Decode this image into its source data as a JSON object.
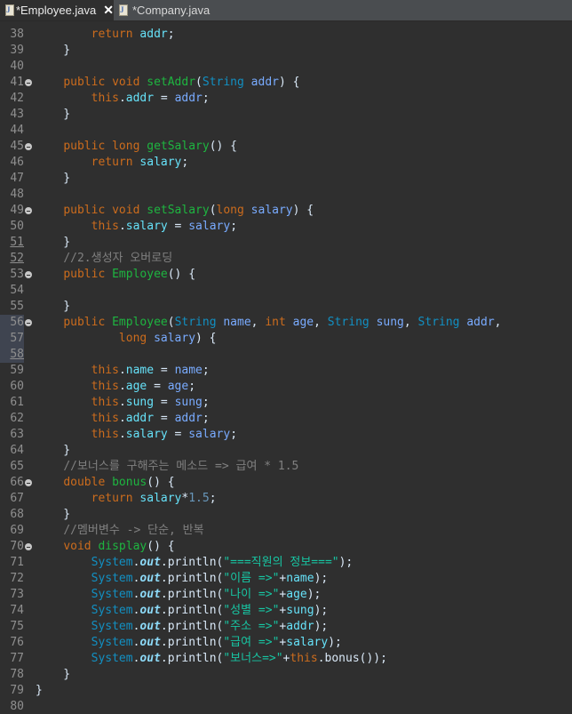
{
  "tabs": [
    {
      "label": "*Employee.java",
      "active": true
    },
    {
      "label": "*Company.java",
      "active": false
    }
  ],
  "icons": {
    "file": "java-file-icon",
    "close": "close-icon"
  },
  "code_lines": [
    {
      "n": "38",
      "text": "        return addr;"
    },
    {
      "n": "39",
      "text": "    }"
    },
    {
      "n": "40",
      "text": ""
    },
    {
      "n": "41",
      "text": "    public void setAddr(String addr) {",
      "fold": true
    },
    {
      "n": "42",
      "text": "        this.addr = addr;"
    },
    {
      "n": "43",
      "text": "    }"
    },
    {
      "n": "44",
      "text": ""
    },
    {
      "n": "45",
      "text": "    public long getSalary() {",
      "fold": true
    },
    {
      "n": "46",
      "text": "        return salary;"
    },
    {
      "n": "47",
      "text": "    }"
    },
    {
      "n": "48",
      "text": ""
    },
    {
      "n": "49",
      "text": "    public void setSalary(long salary) {",
      "fold": true
    },
    {
      "n": "50",
      "text": "        this.salary = salary;"
    },
    {
      "n": "51",
      "text": "    }"
    },
    {
      "n": "52",
      "text": "    //2.생성자 오버로딩"
    },
    {
      "n": "53",
      "text": "    public Employee() {",
      "fold": true
    },
    {
      "n": "54",
      "text": ""
    },
    {
      "n": "55",
      "text": "    }"
    },
    {
      "n": "56",
      "text": "    public Employee(String name, int age, String sung, String addr,",
      "fold": true
    },
    {
      "n": "57",
      "text": "            long salary) {"
    },
    {
      "n": "58",
      "text": ""
    },
    {
      "n": "59",
      "text": "        this.name = name;"
    },
    {
      "n": "60",
      "text": "        this.age = age;"
    },
    {
      "n": "61",
      "text": "        this.sung = sung;"
    },
    {
      "n": "62",
      "text": "        this.addr = addr;"
    },
    {
      "n": "63",
      "text": "        this.salary = salary;"
    },
    {
      "n": "64",
      "text": "    }"
    },
    {
      "n": "65",
      "text": "    //보너스를 구해주는 메소드 => 급여 * 1.5"
    },
    {
      "n": "66",
      "text": "    double bonus() {",
      "fold": true
    },
    {
      "n": "67",
      "text": "        return salary*1.5;"
    },
    {
      "n": "68",
      "text": "    }"
    },
    {
      "n": "69",
      "text": "    //멤버변수 -> 단순, 반복"
    },
    {
      "n": "70",
      "text": "    void display() {",
      "fold": true
    },
    {
      "n": "71",
      "text": "        System.out.println(\"===직원의 정보===\");"
    },
    {
      "n": "72",
      "text": "        System.out.println(\"이름 =>\"+name);"
    },
    {
      "n": "73",
      "text": "        System.out.println(\"나이 =>\"+age);"
    },
    {
      "n": "74",
      "text": "        System.out.println(\"성별 =>\"+sung);"
    },
    {
      "n": "75",
      "text": "        System.out.println(\"주소 =>\"+addr);"
    },
    {
      "n": "76",
      "text": "        System.out.println(\"급여 =>\"+salary);"
    },
    {
      "n": "77",
      "text": "        System.out.println(\"보너스=>\"+this.bonus());"
    },
    {
      "n": "78",
      "text": "    }"
    },
    {
      "n": "79",
      "text": "}"
    },
    {
      "n": "80",
      "text": ""
    }
  ]
}
